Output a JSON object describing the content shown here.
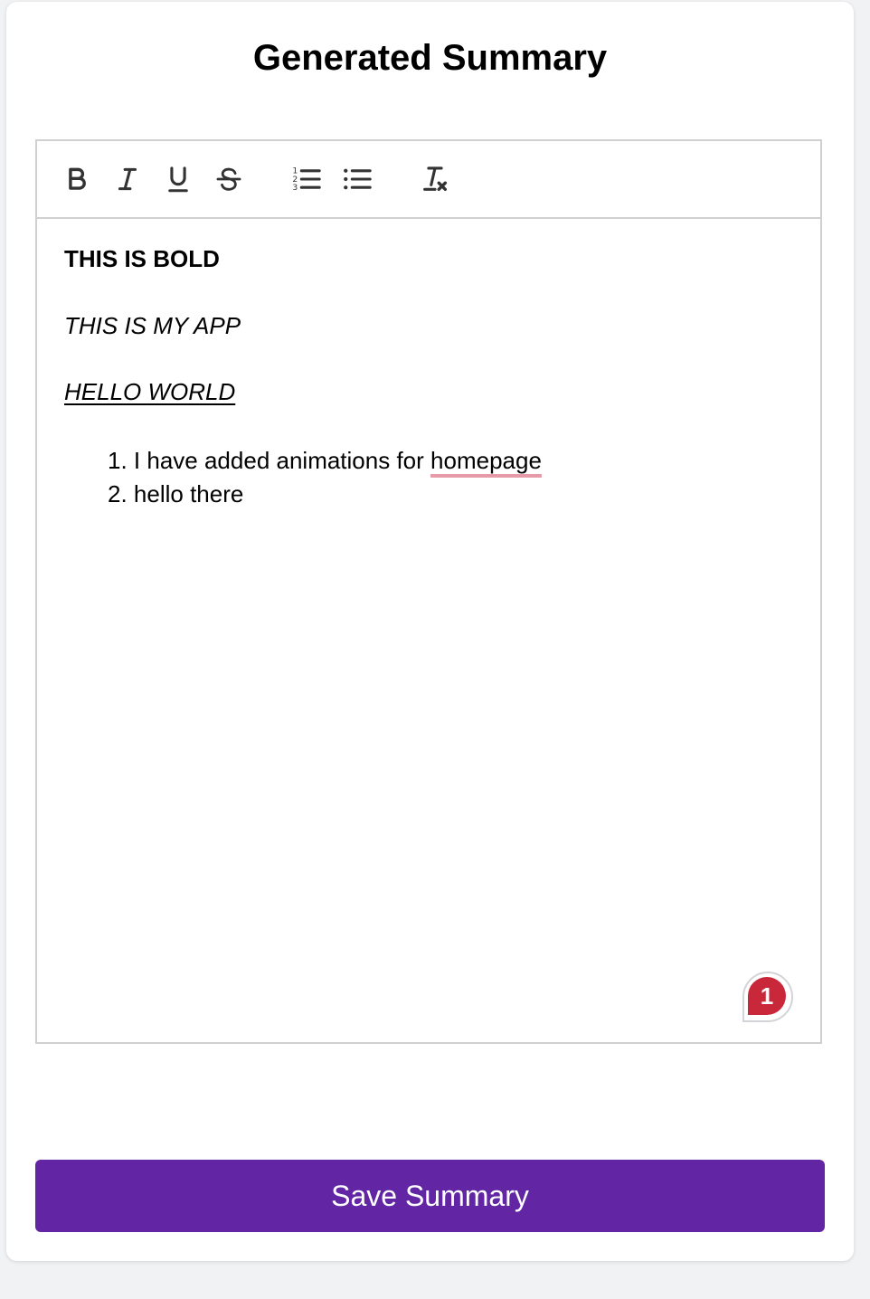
{
  "page": {
    "title": "Generated Summary"
  },
  "toolbar": {
    "buttons": [
      {
        "icon": "bold-icon",
        "label": "Bold"
      },
      {
        "icon": "italic-icon",
        "label": "Italic"
      },
      {
        "icon": "underline-icon",
        "label": "Underline"
      },
      {
        "icon": "strikethrough-icon",
        "label": "Strikethrough"
      },
      {
        "icon": "ordered-list-icon",
        "label": "Ordered list"
      },
      {
        "icon": "bullet-list-icon",
        "label": "Bullet list"
      },
      {
        "icon": "clear-format-icon",
        "label": "Clear formatting"
      }
    ]
  },
  "editor": {
    "bold_line": "THIS IS BOLD",
    "italic_line": "THIS IS MY APP",
    "underline_line": "HELLO WORLD",
    "list": [
      {
        "number": "1.",
        "text_before": "I have added animations for ",
        "misspelled": "homepage"
      },
      {
        "number": "2.",
        "text_before": "hello there",
        "misspelled": ""
      }
    ]
  },
  "grammar_badge": {
    "count": "1",
    "color": "#c8283a"
  },
  "actions": {
    "save_label": "Save Summary",
    "save_color": "#6226a4"
  }
}
